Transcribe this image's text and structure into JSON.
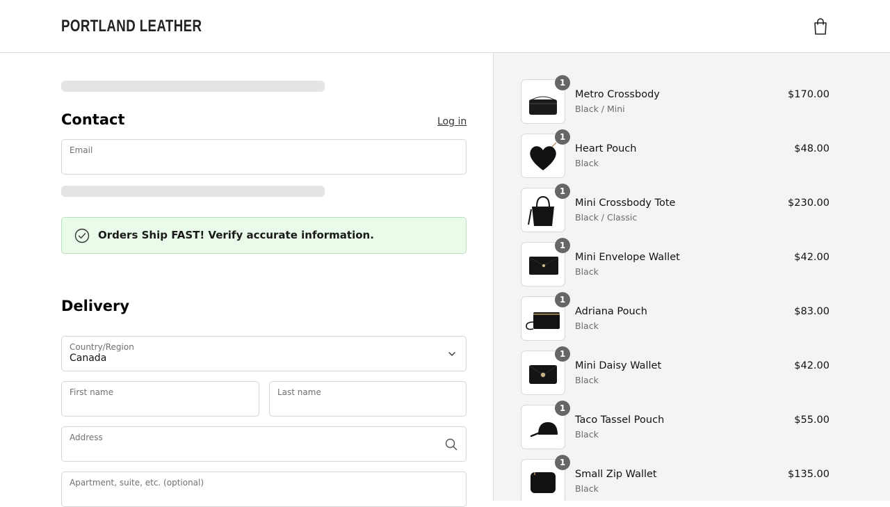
{
  "header": {
    "brand": "PORTLAND LEATHER",
    "cart_icon": "shopping-bag-icon"
  },
  "contact": {
    "title": "Contact",
    "login_label": "Log in",
    "email": {
      "label": "Email",
      "value": ""
    }
  },
  "notice": {
    "text": "Orders Ship FAST! Verify accurate information.",
    "icon": "check-circle-icon"
  },
  "delivery": {
    "title": "Delivery",
    "country": {
      "label": "Country/Region",
      "value": "Canada"
    },
    "first_name": {
      "label": "First name",
      "value": ""
    },
    "last_name": {
      "label": "Last name",
      "value": ""
    },
    "address": {
      "label": "Address",
      "value": ""
    },
    "apartment": {
      "label": "Apartment, suite, etc. (optional)",
      "value": ""
    }
  },
  "order": {
    "items": [
      {
        "name": "Metro Crossbody",
        "variant": "Black / Mini",
        "price": "$170.00",
        "qty": "1"
      },
      {
        "name": "Heart Pouch",
        "variant": "Black",
        "price": "$48.00",
        "qty": "1"
      },
      {
        "name": "Mini Crossbody Tote",
        "variant": "Black / Classic",
        "price": "$230.00",
        "qty": "1"
      },
      {
        "name": "Mini Envelope Wallet",
        "variant": "Black",
        "price": "$42.00",
        "qty": "1"
      },
      {
        "name": "Adriana Pouch",
        "variant": "Black",
        "price": "$83.00",
        "qty": "1"
      },
      {
        "name": "Mini Daisy Wallet",
        "variant": "Black",
        "price": "$42.00",
        "qty": "1"
      },
      {
        "name": "Taco Tassel Pouch",
        "variant": "Black",
        "price": "$55.00",
        "qty": "1"
      },
      {
        "name": "Small Zip Wallet",
        "variant": "Black",
        "price": "$135.00",
        "qty": "1"
      }
    ]
  },
  "colors": {
    "notice_bg": "#eafbea",
    "notice_border": "#b9dfbd",
    "summary_bg": "#f4f4f4",
    "badge": "#666666"
  }
}
